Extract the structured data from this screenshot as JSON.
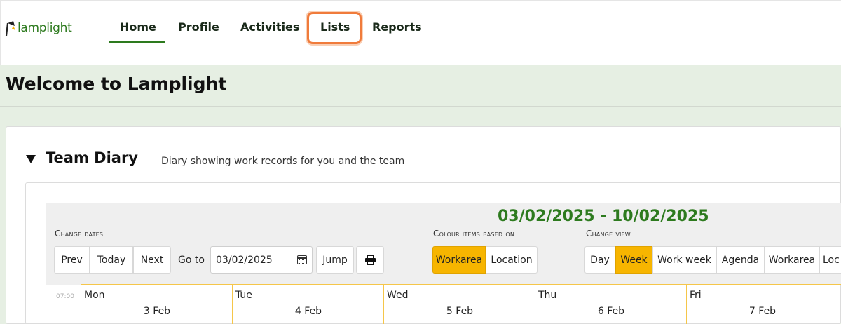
{
  "app": {
    "logo_text": "lamplight",
    "brand_color": "#2d7a1e",
    "accent_color": "#f7b500",
    "highlight_color": "#f07b3b"
  },
  "nav": {
    "items": [
      {
        "label": "Home",
        "active": true
      },
      {
        "label": "Profile"
      },
      {
        "label": "Activities"
      },
      {
        "label": "Lists",
        "highlighted": true
      },
      {
        "label": "Reports"
      }
    ]
  },
  "welcome": {
    "title": "Welcome to Lamplight"
  },
  "diary": {
    "title": "Team Diary",
    "subtitle": "Diary showing work records for you and the team",
    "date_range": "03/02/2025 - 10/02/2025",
    "change_dates": {
      "label": "Change dates",
      "prev": "Prev",
      "today": "Today",
      "next": "Next",
      "goto_label": "Go to",
      "goto_value": "03/02/2025",
      "jump": "Jump",
      "print_icon": "printer-icon"
    },
    "colour_items": {
      "label": "Colour items based on",
      "options": [
        "Workarea",
        "Location"
      ],
      "selected": "Workarea"
    },
    "change_view": {
      "label": "Change view",
      "options": [
        "Day",
        "Week",
        "Work week",
        "Agenda",
        "Workarea",
        "Loc"
      ],
      "selected": "Week"
    },
    "time_start": "07:00",
    "days": [
      {
        "name": "Mon",
        "date": "3 Feb"
      },
      {
        "name": "Tue",
        "date": "4 Feb"
      },
      {
        "name": "Wed",
        "date": "5 Feb"
      },
      {
        "name": "Thu",
        "date": "6 Feb"
      },
      {
        "name": "Fri",
        "date": "7 Feb"
      }
    ]
  }
}
